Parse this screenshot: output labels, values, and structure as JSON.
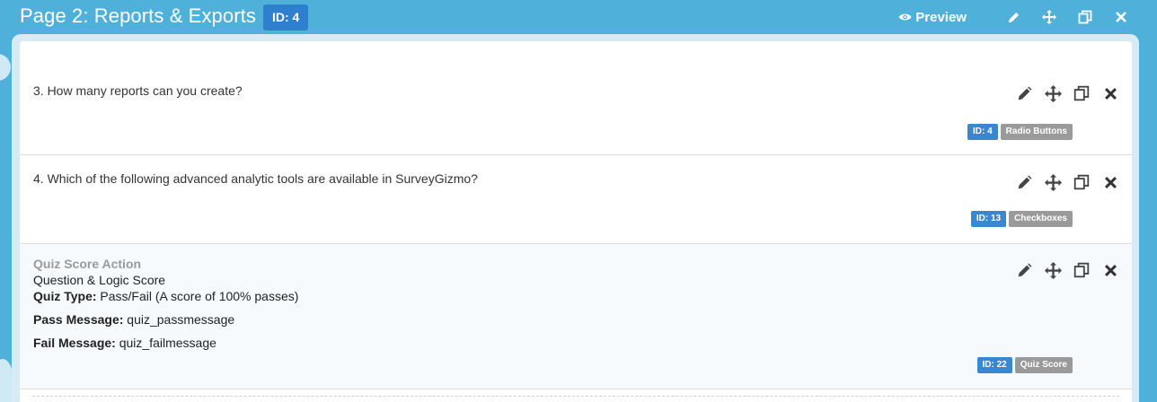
{
  "header": {
    "title": "Page 2: Reports & Exports",
    "id_badge": "ID: 4",
    "preview_label": "Preview"
  },
  "questions": [
    {
      "text": "3. How many reports can you create?",
      "id_tag": "ID: 4",
      "type_tag": "Radio Buttons"
    },
    {
      "text": "4. Which of the following advanced analytic tools are available in SurveyGizmo?",
      "id_tag": "ID: 13",
      "type_tag": "Checkboxes"
    }
  ],
  "quiz_action": {
    "title": "Quiz Score Action",
    "subtitle": "Question & Logic Score",
    "quiz_type_label": "Quiz Type:",
    "quiz_type_value": "Pass/Fail (A score of 100% passes)",
    "pass_label": "Pass Message:",
    "pass_value": "quiz_passmessage",
    "fail_label": "Fail Message:",
    "fail_value": "quiz_failmessage",
    "id_tag": "ID: 22",
    "type_tag": "Quiz Score"
  },
  "colors": {
    "header_bg": "#4fb1da",
    "badge_blue": "#2f7fcf",
    "tag_blue": "#3a87d1",
    "tag_gray": "#9a9a9a"
  }
}
